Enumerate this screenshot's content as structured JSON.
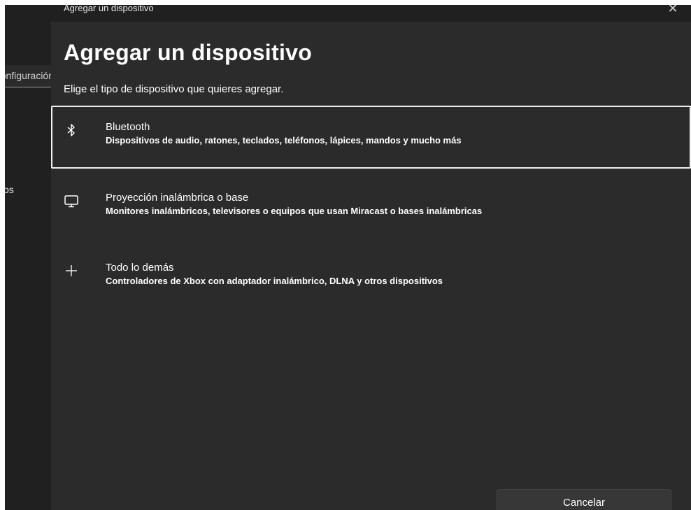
{
  "background_window": {
    "search_text": "Configuración",
    "nav_item_fragment": "os"
  },
  "dialog": {
    "window_title": "Agregar un dispositivo",
    "heading": "Agregar un dispositivo",
    "subheading": "Elige el tipo de dispositivo que quieres agregar.",
    "options": [
      {
        "icon": "bluetooth-icon",
        "title": "Bluetooth",
        "description": "Dispositivos de audio, ratones, teclados, teléfonos, lápices, mandos y mucho más",
        "focused": true
      },
      {
        "icon": "monitor-icon",
        "title": "Proyección inalámbrica o base",
        "description": "Monitores inalámbricos, televisores o equipos que usan Miracast o bases inalámbricas",
        "focused": false
      },
      {
        "icon": "plus-icon",
        "title": "Todo lo demás",
        "description": "Controladores de Xbox con adaptador inalámbrico, DLNA y otros dispositivos",
        "focused": false
      }
    ],
    "cancel_label": "Cancelar"
  },
  "colors": {
    "dialog_background": "#2b2b2b",
    "titlebar_background": "#202020",
    "focus_border": "#f0f0f0",
    "text": "#ffffff"
  }
}
